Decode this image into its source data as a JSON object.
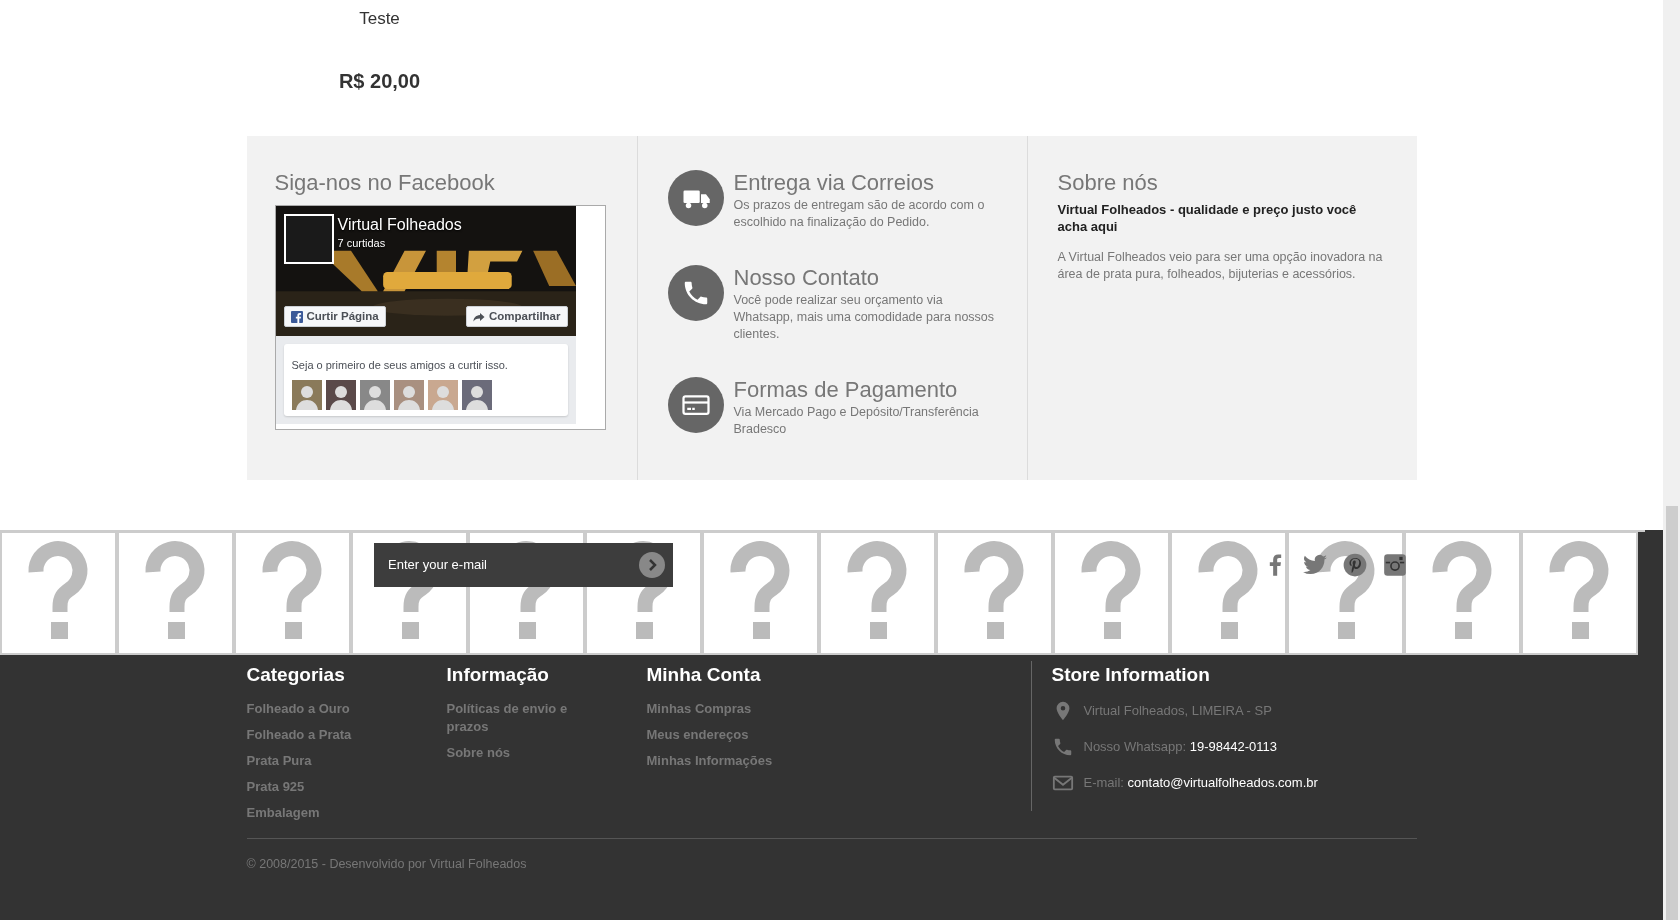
{
  "product": {
    "name": "Teste",
    "price": "R$ 20,00"
  },
  "facebook": {
    "title": "Siga-nos no Facebook",
    "page_name": "Virtual Folheados",
    "likes": "7 curtidas",
    "like_button": "Curtir Página",
    "share_button": "Compartilhar",
    "friends_text": "Seja o primeiro de seus amigos a curtir isso.",
    "friend_avatars": [
      {
        "kind": "avatar"
      },
      {
        "kind": "avatar"
      },
      {
        "kind": "avatar"
      },
      {
        "kind": "avatar"
      },
      {
        "kind": "avatar"
      },
      {
        "kind": "avatar"
      }
    ]
  },
  "features": [
    {
      "kind": "truck",
      "title": "Entrega via Correios",
      "text": "Os prazos de entregam são de acordo com o escolhido na finalização do Pedido."
    },
    {
      "kind": "phone",
      "title": "Nosso Contato",
      "text": "Você pode realizar seu orçamento via Whatsapp, mais uma comodidade para nossos clientes."
    },
    {
      "kind": "card",
      "title": "Formas de Pagamento",
      "text": "Via Mercado Pago e Depósito/Transferência Bradesco"
    }
  ],
  "about": {
    "title": "Sobre nós",
    "subtitle": "Virtual Folheados - qualidade e preço justo você acha aqui",
    "text": "A Virtual Folheados veio para ser uma opção inovadora na área de prata pura, folheados, bijuterias e acessórios."
  },
  "newsletter": {
    "placeholder": "Enter your e-mail"
  },
  "social": [
    {
      "kind": "facebook"
    },
    {
      "kind": "twitter"
    },
    {
      "kind": "pinterest"
    },
    {
      "kind": "instagram"
    }
  ],
  "broken_images": [
    {
      "kind": "broken"
    },
    {
      "kind": "broken"
    },
    {
      "kind": "broken"
    },
    {
      "kind": "broken"
    },
    {
      "kind": "broken"
    },
    {
      "kind": "broken"
    },
    {
      "kind": "broken"
    },
    {
      "kind": "broken"
    },
    {
      "kind": "broken"
    },
    {
      "kind": "broken"
    },
    {
      "kind": "broken"
    },
    {
      "kind": "broken"
    },
    {
      "kind": "broken"
    },
    {
      "kind": "broken"
    }
  ],
  "footer_columns": [
    {
      "title": "Categorias",
      "links": [
        "Folheado a Ouro",
        "Folheado a Prata",
        "Prata Pura",
        "Prata 925",
        "Embalagem"
      ]
    },
    {
      "title": "Informação",
      "links": [
        "Políticas de envio e prazos",
        "Sobre nós"
      ]
    },
    {
      "title": "Minha Conta",
      "links": [
        "Minhas Compras",
        "Meus endereços",
        "Minhas Informações"
      ]
    }
  ],
  "store_info": {
    "title": "Store Information",
    "items": [
      {
        "kind": "pin",
        "label": "Virtual Folheados, LIMEIRA - SP"
      },
      {
        "kind": "phone",
        "label": "Nosso Whatsapp:",
        "value": "19-98442-0113"
      },
      {
        "kind": "mail",
        "label": "E-mail:",
        "value": "contato@virtualfolheados.com.br"
      }
    ]
  },
  "copyright": "© 2008/2015 - Desenvolvido por Virtual Folheados"
}
